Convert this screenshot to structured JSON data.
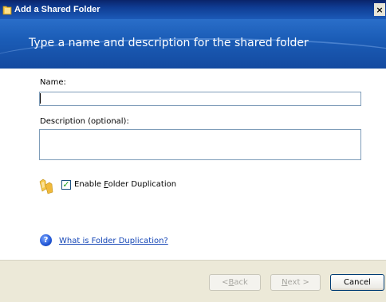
{
  "window": {
    "title": "Add a Shared Folder",
    "close_glyph": "×"
  },
  "banner": {
    "heading": "Type a name and description for the shared folder"
  },
  "form": {
    "name_label": "Name:",
    "name_value": "",
    "description_label": "Description (optional):",
    "description_value": "",
    "duplication_checkbox": {
      "label_prefix": "Enable ",
      "label_accel": "F",
      "label_suffix": "older Duplication",
      "checked": true
    }
  },
  "help": {
    "link_accel": "W",
    "link_rest": "hat is Folder Duplication?"
  },
  "buttons": {
    "back_prefix": "< ",
    "back_accel": "B",
    "back_rest": "ack",
    "next_accel": "N",
    "next_rest": "ext >",
    "cancel": "Cancel"
  },
  "colors": {
    "title_bar": "#0f3d94",
    "banner": "#1b5db7",
    "link": "#1546b6",
    "footer": "#ece9d8",
    "checkmark": "#21a121"
  },
  "icons": {
    "app": "folder-icon",
    "close": "close-icon",
    "duplication": "folder-duplication-icon",
    "help": "help-question-icon",
    "checkbox": "checkmark-icon"
  }
}
